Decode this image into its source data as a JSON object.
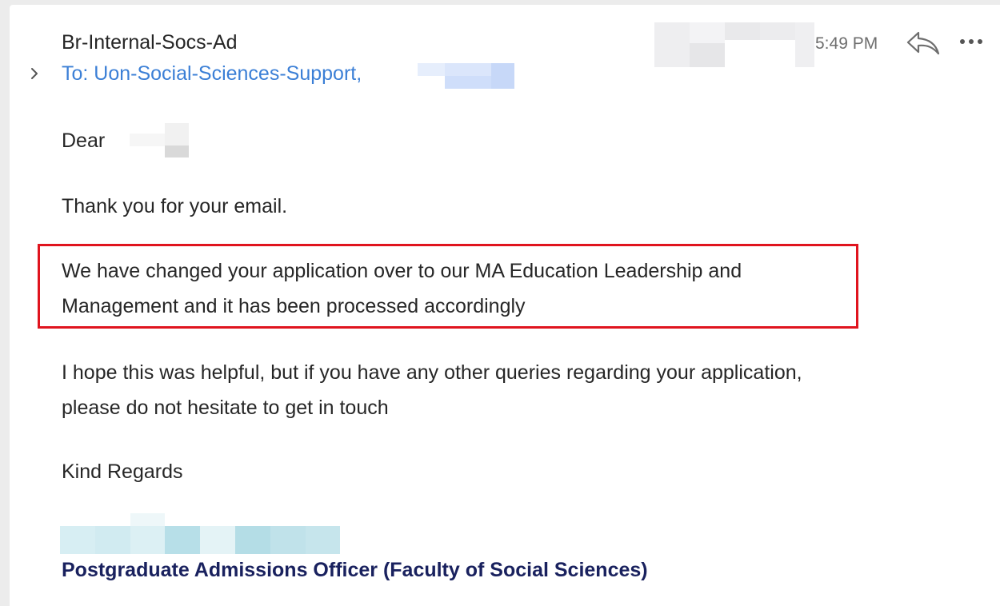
{
  "header": {
    "sender": "Br-Internal-Socs-Ad",
    "recipients": "To: Uon-Social-Sciences-Support,",
    "time": "5:49 PM"
  },
  "icons": {
    "expand": "chevron-right-icon",
    "reply": "reply-icon",
    "more": "more-horizontal-icon"
  },
  "body": {
    "greeting": "Dear",
    "thanks": "Thank you for your email.",
    "highlight_line1": "We have changed your application over to our MA Education Leadership and",
    "highlight_line2": "Management and it has been processed accordingly",
    "help_line1": "I hope this was helpful, but if you have any other queries regarding your application,",
    "help_line2": "please do not hesitate to get in touch",
    "signoff": "Kind Regards"
  },
  "signature": {
    "title": "Postgraduate Admissions Officer (Faculty of Social Sciences)"
  },
  "colors": {
    "link": "#3b7fd6",
    "highlight_border": "#e0141e",
    "signature_title": "#19215e",
    "text": "#262626"
  }
}
